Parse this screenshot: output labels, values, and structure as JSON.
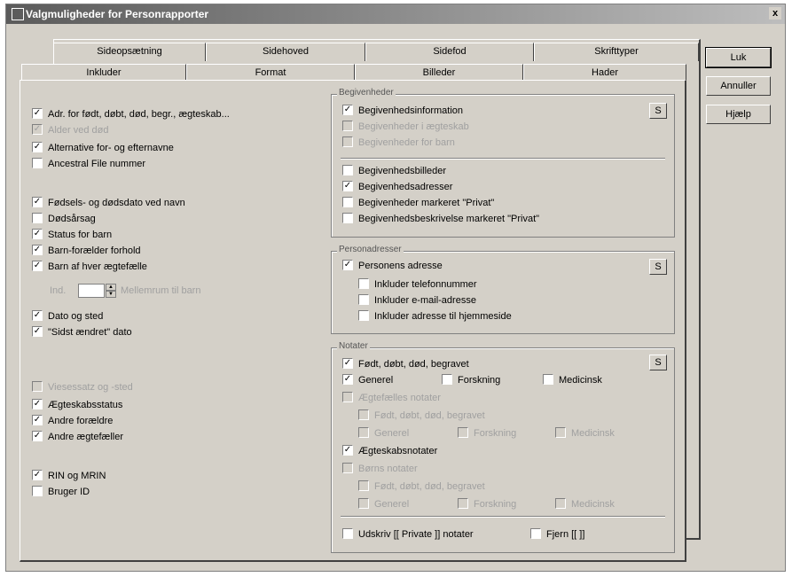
{
  "window": {
    "title": "Valgmuligheder for Personrapporter",
    "close": "x"
  },
  "tabs_back": [
    "Sideopsætning",
    "Sidehoved",
    "Sidefod",
    "Skrifttyper"
  ],
  "tabs_front": [
    "Inkluder",
    "Format",
    "Billeder",
    "Hader"
  ],
  "buttons": {
    "ok": "Luk",
    "cancel": "Annuller",
    "help": "Hjælp"
  },
  "left": [
    {
      "label": "Adr. for født, døbt, død, begr., ægteskab...",
      "checked": true,
      "disabled": false
    },
    {
      "label": "Alder ved død",
      "checked": true,
      "disabled": true
    },
    {
      "label": "Alternative for- og efternavne",
      "checked": true,
      "disabled": false
    },
    {
      "label": "Ancestral File nummer",
      "checked": false,
      "disabled": false
    },
    {
      "label": "Fødsels- og dødsdato ved navn",
      "checked": true,
      "disabled": false
    },
    {
      "label": "Dødsårsag",
      "checked": false,
      "disabled": false
    },
    {
      "label": "Status for barn",
      "checked": true,
      "disabled": false
    },
    {
      "label": "Barn-forælder forhold",
      "checked": true,
      "disabled": false
    },
    {
      "label": "Barn af hver ægtefælle",
      "checked": true,
      "disabled": false
    },
    {
      "label": "Dato og sted",
      "checked": true,
      "disabled": false
    },
    {
      "label": "\"Sidst ændret\" dato",
      "checked": true,
      "disabled": false
    },
    {
      "label": "Viesessatz og -sted",
      "checked": false,
      "disabled": true
    },
    {
      "label": "Ægteskabsstatus",
      "checked": true,
      "disabled": false
    },
    {
      "label": "Andre forældre",
      "checked": true,
      "disabled": false
    },
    {
      "label": "Andre ægtefæller",
      "checked": true,
      "disabled": false
    },
    {
      "label": "RIN og MRIN",
      "checked": true,
      "disabled": false
    },
    {
      "label": "Bruger ID",
      "checked": false,
      "disabled": false
    }
  ],
  "spinner": {
    "prefix": "Ind.",
    "value": "",
    "suffix": "Mellemrum til barn"
  },
  "groups": {
    "events": {
      "title": "Begivenheder",
      "button": "S",
      "items": [
        {
          "label": "Begivenhedsinformation",
          "checked": true,
          "disabled": false
        },
        {
          "label": "Begivenheder i ægteskab",
          "checked": false,
          "disabled": true
        },
        {
          "label": "Begivenheder for barn",
          "checked": false,
          "disabled": true
        },
        {
          "label": "Begivenhedsbilleder",
          "checked": false,
          "disabled": false
        },
        {
          "label": "Begivenhedsadresser",
          "checked": true,
          "disabled": false
        },
        {
          "label": "Begivenheder markeret \"Privat\"",
          "checked": false,
          "disabled": false
        },
        {
          "label": "Begivenhedsbeskrivelse markeret \"Privat\"",
          "checked": false,
          "disabled": false
        }
      ]
    },
    "address": {
      "title": "Personadresser",
      "button": "S",
      "items": [
        {
          "label": "Personens adresse",
          "checked": true,
          "disabled": false
        },
        {
          "label": "Inkluder telefonnummer",
          "checked": false,
          "disabled": false
        },
        {
          "label": "Inkluder e-mail-adresse",
          "checked": false,
          "disabled": false
        },
        {
          "label": "Inkluder adresse til hjemmeside",
          "checked": false,
          "disabled": false
        }
      ]
    },
    "notes": {
      "title": "Notater",
      "button": "S",
      "items": [
        {
          "label": "Født, døbt, død, begravet",
          "checked": true,
          "disabled": false
        },
        {
          "label": "Generel",
          "checked": true,
          "disabled": false
        },
        {
          "label": "Forskning",
          "checked": false,
          "disabled": false
        },
        {
          "label": "Medicinsk",
          "checked": false,
          "disabled": false
        },
        {
          "label": "Ægtefælles notater",
          "checked": false,
          "disabled": true
        },
        {
          "label": "Født, døbt, død, begravet",
          "checked": false,
          "disabled": true
        },
        {
          "label": "Generel",
          "checked": false,
          "disabled": true
        },
        {
          "label": "Forskning",
          "checked": false,
          "disabled": true
        },
        {
          "label": "Medicinsk",
          "checked": false,
          "disabled": true
        },
        {
          "label": "Ægteskabsnotater",
          "checked": true,
          "disabled": false
        },
        {
          "label": "Børns notater",
          "checked": false,
          "disabled": true
        },
        {
          "label": "Født, døbt, død, begravet",
          "checked": false,
          "disabled": true
        },
        {
          "label": "Generel",
          "checked": false,
          "disabled": true
        },
        {
          "label": "Forskning",
          "checked": false,
          "disabled": true
        },
        {
          "label": "Medicinsk",
          "checked": false,
          "disabled": true
        },
        {
          "label": "Udskriv [[ Private ]] notater",
          "checked": false,
          "disabled": false
        },
        {
          "label": "Fjern [[ ]]",
          "checked": false,
          "disabled": false
        }
      ]
    }
  }
}
